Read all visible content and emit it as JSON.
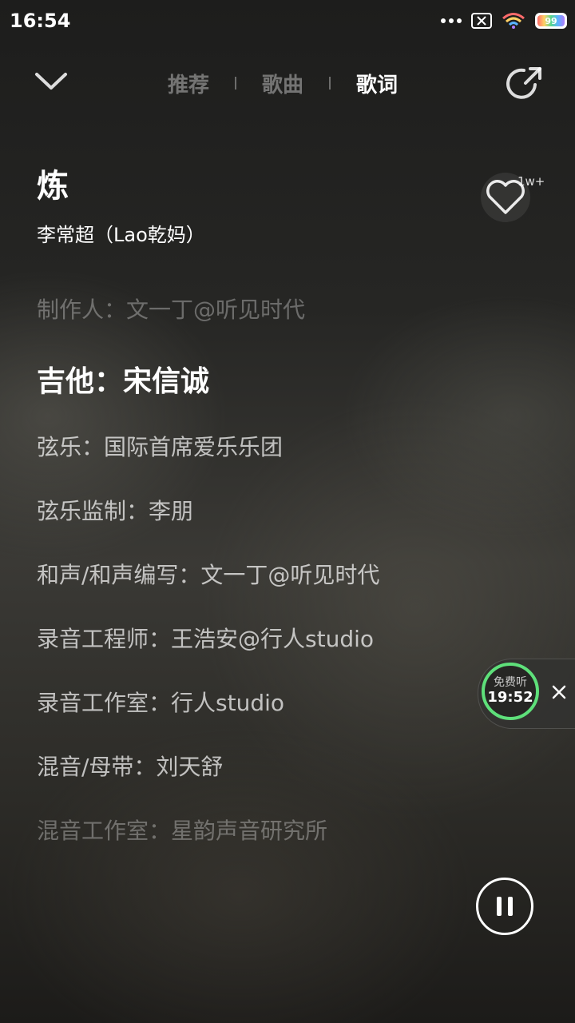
{
  "status_bar": {
    "time": "16:54",
    "battery": "99",
    "icons": [
      "more-dots-icon",
      "sim-off-icon",
      "wifi-icon",
      "battery-icon"
    ]
  },
  "nav": {
    "back_icon": "chevron-down-icon",
    "tabs": [
      {
        "label": "推荐",
        "active": false
      },
      {
        "label": "歌曲",
        "active": false
      },
      {
        "label": "歌词",
        "active": true
      }
    ],
    "share_icon": "share-icon"
  },
  "song": {
    "title": "炼",
    "artist": "李常超（Lao乾妈）",
    "like_count": "1w+"
  },
  "lyrics": [
    {
      "text": "制作人：文一丁@听见时代",
      "state": "faded"
    },
    {
      "text": "吉他：宋信诚",
      "state": "current"
    },
    {
      "text": "弦乐：国际首席爱乐乐团",
      "state": "normal"
    },
    {
      "text": "弦乐监制：李朋",
      "state": "normal"
    },
    {
      "text": "和声/和声编写：文一丁@听见时代",
      "state": "normal"
    },
    {
      "text": "录音工程师：王浩安@行人studio",
      "state": "normal"
    },
    {
      "text": "录音工作室：行人studio",
      "state": "normal"
    },
    {
      "text": "混音/母带：刘天舒",
      "state": "normal"
    },
    {
      "text": "混音工作室：星韵声音研究所",
      "state": "faded"
    }
  ],
  "free_listen": {
    "label": "免费听",
    "time": "19:52"
  },
  "player": {
    "state": "playing"
  },
  "colors": {
    "accent_green": "#5ee07a"
  }
}
